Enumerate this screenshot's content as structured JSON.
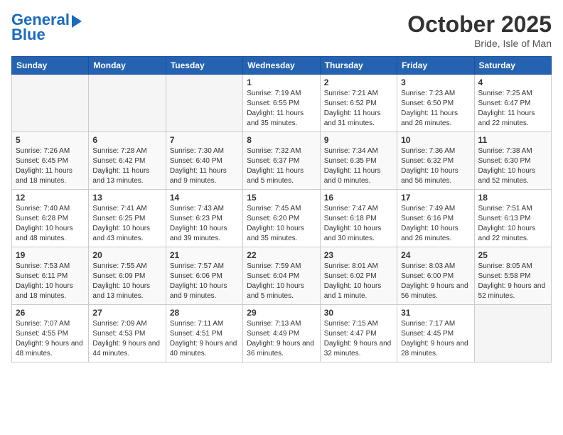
{
  "header": {
    "logo_line1": "General",
    "logo_line2": "Blue",
    "month": "October 2025",
    "location": "Bride, Isle of Man"
  },
  "days_of_week": [
    "Sunday",
    "Monday",
    "Tuesday",
    "Wednesday",
    "Thursday",
    "Friday",
    "Saturday"
  ],
  "weeks": [
    [
      {
        "day": "",
        "info": ""
      },
      {
        "day": "",
        "info": ""
      },
      {
        "day": "",
        "info": ""
      },
      {
        "day": "1",
        "info": "Sunrise: 7:19 AM\nSunset: 6:55 PM\nDaylight: 11 hours and 35 minutes."
      },
      {
        "day": "2",
        "info": "Sunrise: 7:21 AM\nSunset: 6:52 PM\nDaylight: 11 hours and 31 minutes."
      },
      {
        "day": "3",
        "info": "Sunrise: 7:23 AM\nSunset: 6:50 PM\nDaylight: 11 hours and 26 minutes."
      },
      {
        "day": "4",
        "info": "Sunrise: 7:25 AM\nSunset: 6:47 PM\nDaylight: 11 hours and 22 minutes."
      }
    ],
    [
      {
        "day": "5",
        "info": "Sunrise: 7:26 AM\nSunset: 6:45 PM\nDaylight: 11 hours and 18 minutes."
      },
      {
        "day": "6",
        "info": "Sunrise: 7:28 AM\nSunset: 6:42 PM\nDaylight: 11 hours and 13 minutes."
      },
      {
        "day": "7",
        "info": "Sunrise: 7:30 AM\nSunset: 6:40 PM\nDaylight: 11 hours and 9 minutes."
      },
      {
        "day": "8",
        "info": "Sunrise: 7:32 AM\nSunset: 6:37 PM\nDaylight: 11 hours and 5 minutes."
      },
      {
        "day": "9",
        "info": "Sunrise: 7:34 AM\nSunset: 6:35 PM\nDaylight: 11 hours and 0 minutes."
      },
      {
        "day": "10",
        "info": "Sunrise: 7:36 AM\nSunset: 6:32 PM\nDaylight: 10 hours and 56 minutes."
      },
      {
        "day": "11",
        "info": "Sunrise: 7:38 AM\nSunset: 6:30 PM\nDaylight: 10 hours and 52 minutes."
      }
    ],
    [
      {
        "day": "12",
        "info": "Sunrise: 7:40 AM\nSunset: 6:28 PM\nDaylight: 10 hours and 48 minutes."
      },
      {
        "day": "13",
        "info": "Sunrise: 7:41 AM\nSunset: 6:25 PM\nDaylight: 10 hours and 43 minutes."
      },
      {
        "day": "14",
        "info": "Sunrise: 7:43 AM\nSunset: 6:23 PM\nDaylight: 10 hours and 39 minutes."
      },
      {
        "day": "15",
        "info": "Sunrise: 7:45 AM\nSunset: 6:20 PM\nDaylight: 10 hours and 35 minutes."
      },
      {
        "day": "16",
        "info": "Sunrise: 7:47 AM\nSunset: 6:18 PM\nDaylight: 10 hours and 30 minutes."
      },
      {
        "day": "17",
        "info": "Sunrise: 7:49 AM\nSunset: 6:16 PM\nDaylight: 10 hours and 26 minutes."
      },
      {
        "day": "18",
        "info": "Sunrise: 7:51 AM\nSunset: 6:13 PM\nDaylight: 10 hours and 22 minutes."
      }
    ],
    [
      {
        "day": "19",
        "info": "Sunrise: 7:53 AM\nSunset: 6:11 PM\nDaylight: 10 hours and 18 minutes."
      },
      {
        "day": "20",
        "info": "Sunrise: 7:55 AM\nSunset: 6:09 PM\nDaylight: 10 hours and 13 minutes."
      },
      {
        "day": "21",
        "info": "Sunrise: 7:57 AM\nSunset: 6:06 PM\nDaylight: 10 hours and 9 minutes."
      },
      {
        "day": "22",
        "info": "Sunrise: 7:59 AM\nSunset: 6:04 PM\nDaylight: 10 hours and 5 minutes."
      },
      {
        "day": "23",
        "info": "Sunrise: 8:01 AM\nSunset: 6:02 PM\nDaylight: 10 hours and 1 minute."
      },
      {
        "day": "24",
        "info": "Sunrise: 8:03 AM\nSunset: 6:00 PM\nDaylight: 9 hours and 56 minutes."
      },
      {
        "day": "25",
        "info": "Sunrise: 8:05 AM\nSunset: 5:58 PM\nDaylight: 9 hours and 52 minutes."
      }
    ],
    [
      {
        "day": "26",
        "info": "Sunrise: 7:07 AM\nSunset: 4:55 PM\nDaylight: 9 hours and 48 minutes."
      },
      {
        "day": "27",
        "info": "Sunrise: 7:09 AM\nSunset: 4:53 PM\nDaylight: 9 hours and 44 minutes."
      },
      {
        "day": "28",
        "info": "Sunrise: 7:11 AM\nSunset: 4:51 PM\nDaylight: 9 hours and 40 minutes."
      },
      {
        "day": "29",
        "info": "Sunrise: 7:13 AM\nSunset: 4:49 PM\nDaylight: 9 hours and 36 minutes."
      },
      {
        "day": "30",
        "info": "Sunrise: 7:15 AM\nSunset: 4:47 PM\nDaylight: 9 hours and 32 minutes."
      },
      {
        "day": "31",
        "info": "Sunrise: 7:17 AM\nSunset: 4:45 PM\nDaylight: 9 hours and 28 minutes."
      },
      {
        "day": "",
        "info": ""
      }
    ]
  ]
}
